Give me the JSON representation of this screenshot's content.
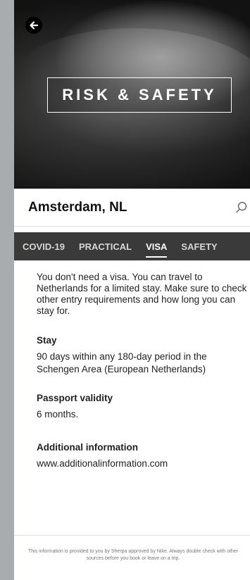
{
  "header": {
    "back_icon": "arrow-left-icon",
    "hero_title": "RISK & SAFETY"
  },
  "location": {
    "name": "Amsterdam, NL",
    "search_icon": "search-icon"
  },
  "tabs": [
    {
      "label": "COVID-19",
      "active": false
    },
    {
      "label": "PRACTICAL",
      "active": false
    },
    {
      "label": "VISA",
      "active": true
    },
    {
      "label": "SAFETY",
      "active": false
    }
  ],
  "content": {
    "intro": "You don't need a visa. You can travel to Netherlands for a limited stay. Make sure to check other entry requirements and how long you can stay for.",
    "sections": [
      {
        "title": "Stay",
        "text": "90 days within any 180-day period in the Schengen Area (European Netherlands)"
      },
      {
        "title": "Passport validity",
        "text": "6 months."
      },
      {
        "title": "Additional information",
        "text": "www.additionalinformation.com"
      }
    ]
  },
  "footer": {
    "disclaimer": "This information is provided to you by Sherpa approved by Nike. Always double check with other sources before you book or leave on a trip."
  },
  "colors": {
    "tab_bar": "#3a3a3a",
    "page_bg": "#a9acae"
  }
}
